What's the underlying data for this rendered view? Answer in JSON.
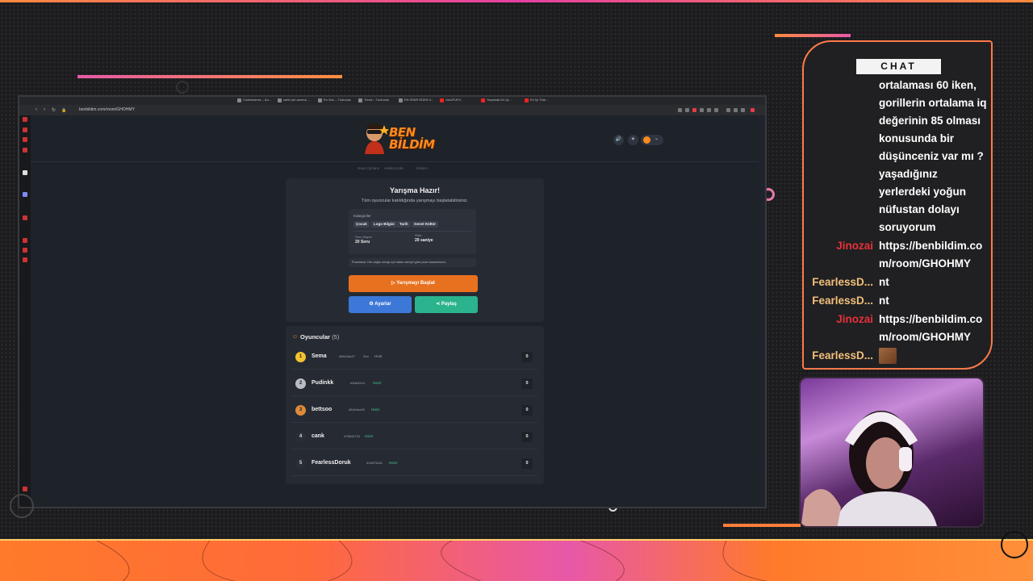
{
  "browser": {
    "tabs": [
      "Codelearnes – Arı...",
      "sarki için acema ...",
      "En Son – Turkuvaz",
      "Trend – Turkuvaz",
      "EN SINIR EDEN II...",
      "UwUFUFU",
      "Yeşamak En İyi...",
      "En İyi Türk..."
    ],
    "address": "benbildim.com/room/GHOHMY"
  },
  "site": {
    "logo_line1": "BEN",
    "logo_line2": "BİLDİM",
    "nav": [
      "Nasıl Oynanır",
      "Hakkımızda",
      "İletişim"
    ]
  },
  "quiz": {
    "title": "Yarışma Hazır!",
    "subtitle": "Tüm oyuncular katıldığında yarışmayı başlatabilirsiniz.",
    "categories_label": "Kategoriler",
    "categories": [
      "Çocuk",
      "Logo Bilgisi",
      "Tarih",
      "Genel Kültür"
    ],
    "question_count_label": "Soru Sayısı",
    "question_count": "20 Soru",
    "time_label": "Süre",
    "time_value": "20 saniye",
    "note": "Puanlama: Her doğru cevap için kalan süreye göre puan kazanırsınız.",
    "start_button": "Yarışmayı Başlat",
    "settings_button": "Ayarlar",
    "share_button": "Paylaş"
  },
  "players": {
    "title": "Oyuncular",
    "count": "(5)",
    "list": [
      {
        "rank": "1",
        "name": "Sema",
        "id": "#8641ab27",
        "tag": "Sen",
        "status": "Host",
        "score": "0",
        "color": "#f2c230"
      },
      {
        "rank": "2",
        "name": "Pudinkk",
        "id": "#9db4244",
        "tag": "",
        "status": "Hazır",
        "score": "0",
        "color": "#b9bcc2"
      },
      {
        "rank": "3",
        "name": "bettsoo",
        "id": "#54e0ac89",
        "tag": "",
        "status": "Hazır",
        "score": "0",
        "color": "#e08a3c"
      },
      {
        "rank": "4",
        "name": "cank",
        "id": "#78642724",
        "tag": "",
        "status": "Hazır",
        "score": "0",
        "color": "#2a2f37"
      },
      {
        "rank": "5",
        "name": "FearlessDoruk",
        "id": "#16579a31",
        "tag": "",
        "status": "Hazır",
        "score": "0",
        "color": "#2a2f37"
      }
    ]
  },
  "chat": {
    "label": "CHAT",
    "messages": [
      {
        "user": "",
        "user_color": "",
        "lines": [
          "ortalaması 60 iken,",
          "gorillerin ortalama iq",
          "değerinin 85 olması",
          "konusunda bir",
          "düşünceniz var mı ?",
          "yaşadığınız",
          "yerlerdeki yoğun",
          "nüfustan dolayı",
          "soruyorum"
        ]
      },
      {
        "user": "Jinozai",
        "user_color": "#e8303a",
        "lines": [
          "https://benbildim.co",
          "m/room/GHOHMY"
        ]
      },
      {
        "user": "FearlessD...",
        "user_color": "#f2c07a",
        "lines": [
          "nt"
        ]
      },
      {
        "user": "FearlessD...",
        "user_color": "#f2c07a",
        "lines": [
          "nt"
        ]
      },
      {
        "user": "Jinozai",
        "user_color": "#e8303a",
        "lines": [
          "https://benbildim.co",
          "m/room/GHOHMY"
        ]
      },
      {
        "user": "FearlessD...",
        "user_color": "#f2c07a",
        "lines": [
          ""
        ]
      }
    ]
  },
  "colors": {
    "accent": "#ff8a3d",
    "start": "#e8711f",
    "settings": "#3d78d8",
    "share": "#2ab38c",
    "chat_border": "#ff7a4a"
  }
}
